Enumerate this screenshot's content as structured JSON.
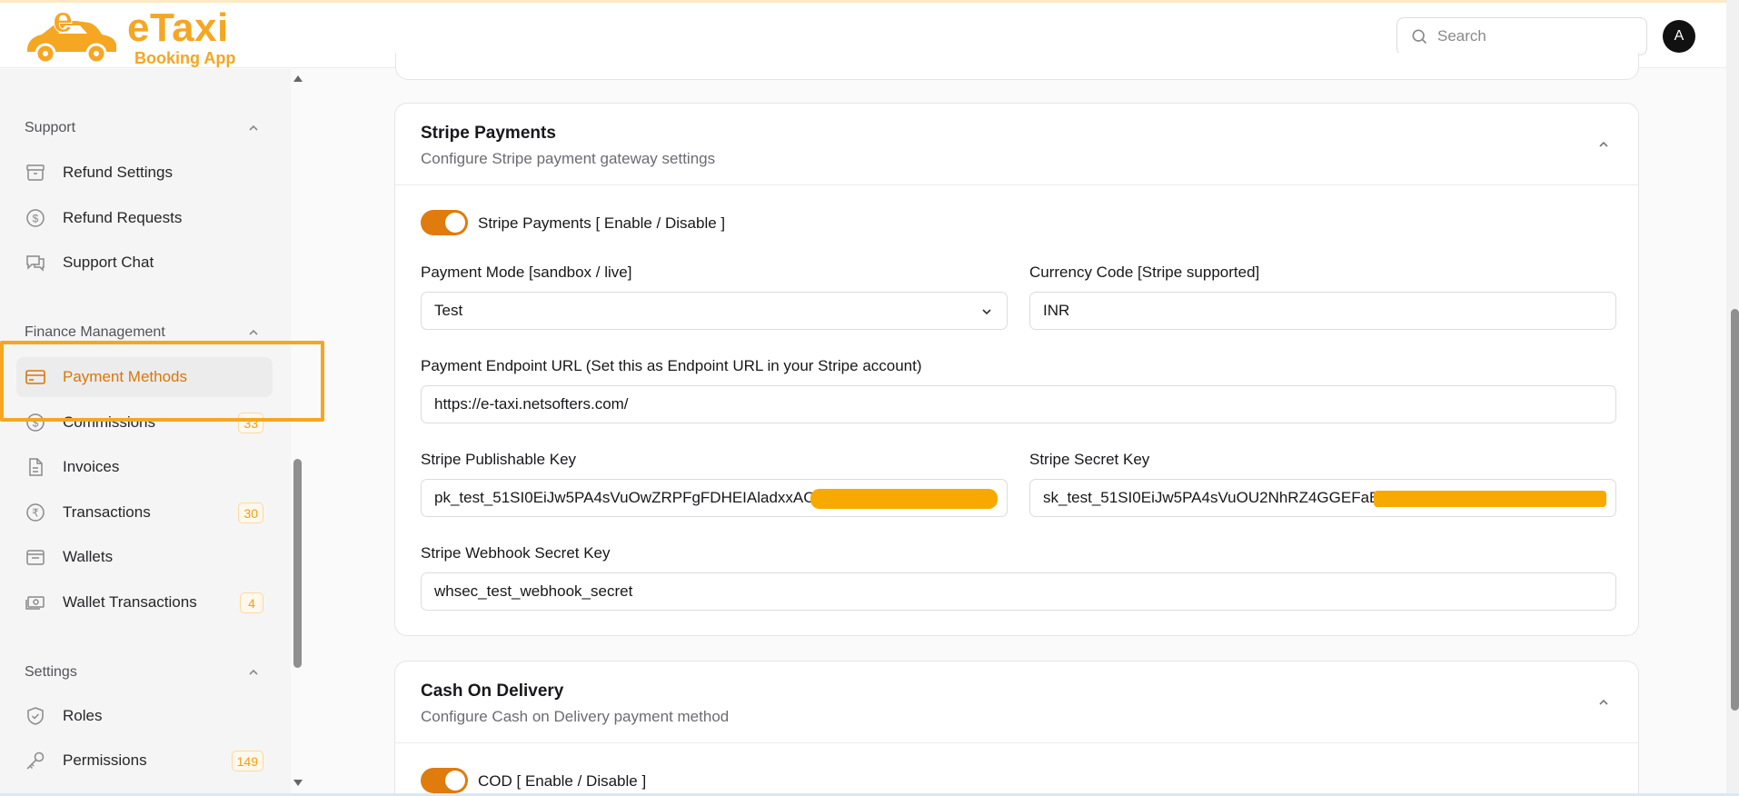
{
  "brand": {
    "title": "eTaxi",
    "subtitle": "Booking App",
    "color": "#f5a623"
  },
  "header": {
    "search_placeholder": "Search",
    "avatar_initial": "A"
  },
  "sidebar": {
    "sections": [
      {
        "title": "Support",
        "items": [
          {
            "label": "Refund Settings",
            "icon": "archive-icon"
          },
          {
            "label": "Refund Requests",
            "icon": "dollar-circle-icon"
          },
          {
            "label": "Support Chat",
            "icon": "chat-icon"
          }
        ]
      },
      {
        "title": "Finance Management",
        "items": [
          {
            "label": "Payment Methods",
            "icon": "credit-card-icon",
            "active": true
          },
          {
            "label": "Commissions",
            "icon": "dollar-circle-icon",
            "badge": "33"
          },
          {
            "label": "Invoices",
            "icon": "file-icon"
          },
          {
            "label": "Transactions",
            "icon": "rupee-circle-icon",
            "badge": "30"
          },
          {
            "label": "Wallets",
            "icon": "wallet-icon"
          },
          {
            "label": "Wallet Transactions",
            "icon": "banknote-icon",
            "badge": "4"
          }
        ]
      },
      {
        "title": "Settings",
        "items": [
          {
            "label": "Roles",
            "icon": "shield-check-icon"
          },
          {
            "label": "Permissions",
            "icon": "key-icon",
            "badge": "149"
          }
        ]
      }
    ]
  },
  "stripe": {
    "title": "Stripe Payments",
    "subtitle": "Configure Stripe payment gateway settings",
    "toggle_label": "Stripe Payments [ Enable / Disable ]",
    "enabled": true,
    "payment_mode_label": "Payment Mode [sandbox / live]",
    "payment_mode_value": "Test",
    "currency_label": "Currency Code [Stripe supported]",
    "currency_value": "INR",
    "endpoint_label": "Payment Endpoint URL (Set this as Endpoint URL in your Stripe account)",
    "endpoint_value": "https://e-taxi.netsofters.com/",
    "publishable_label": "Stripe Publishable Key",
    "publishable_value": "pk_test_51SI0EiJw5PA4sVuOwZRPFgFDHEIAladxxAC3Jc",
    "secret_label": "Stripe Secret Key",
    "secret_value": "sk_test_51SI0EiJw5PA4sVuOU2NhRZ4GGEFaBGt",
    "webhook_label": "Stripe Webhook Secret Key",
    "webhook_value": "whsec_test_webhook_secret"
  },
  "cod": {
    "title": "Cash On Delivery",
    "subtitle": "Configure Cash on Delivery payment method",
    "toggle_label": "COD [ Enable / Disable ]",
    "enabled": true
  },
  "colors": {
    "accent": "#e07b0d",
    "highlight": "#f5a623",
    "redaction": "#f7a900"
  }
}
